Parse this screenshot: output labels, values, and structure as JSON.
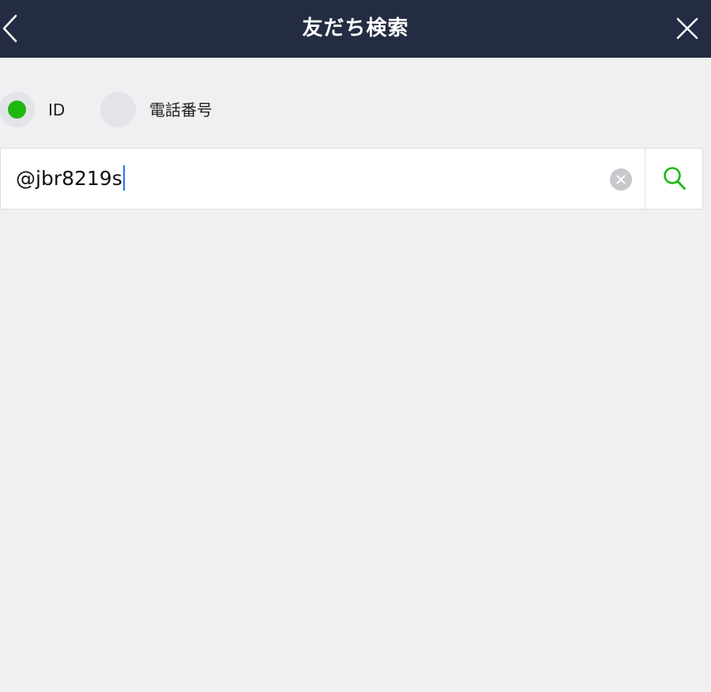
{
  "header": {
    "title": "友だち検索",
    "back_icon": "chevron-left-icon",
    "close_icon": "close-icon"
  },
  "search_type": {
    "options": [
      {
        "label": "ID",
        "selected": true
      },
      {
        "label": "電話番号",
        "selected": false
      }
    ]
  },
  "search": {
    "value": "@jbr8219s",
    "clear_icon": "clear-icon",
    "search_icon": "search-icon"
  },
  "colors": {
    "header_bg": "#232c42",
    "accent": "#1fb80f",
    "page_bg": "#f0f0f2",
    "caret": "#2a6df4"
  }
}
